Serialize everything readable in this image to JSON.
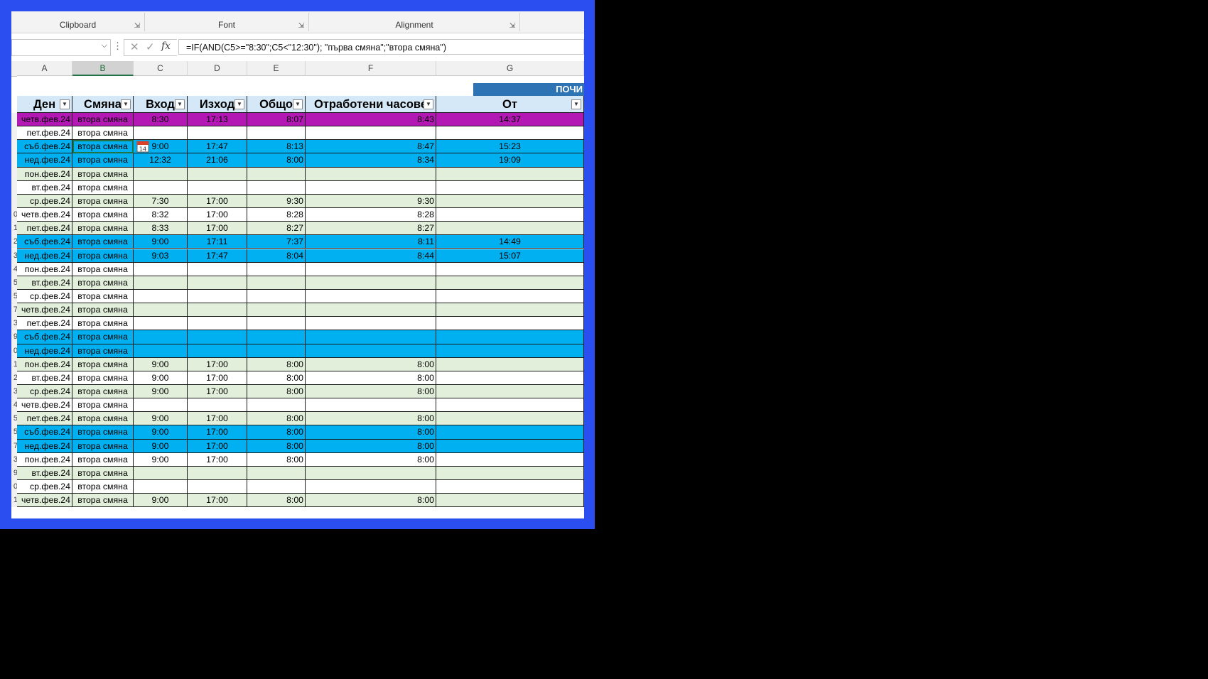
{
  "ribbon": {
    "groups": [
      {
        "label": "Clipboard"
      },
      {
        "label": "Font"
      },
      {
        "label": "Alignment"
      }
    ]
  },
  "formula_bar": {
    "name_box": "",
    "formula": "=IF(AND(C5>=\"8:30\";C5<\"12:30\"); \"първа смяна\";\"втора смяна\")",
    "fx_label": "fx"
  },
  "columns": [
    "A",
    "B",
    "C",
    "D",
    "E",
    "F",
    "G"
  ],
  "selected_column": "B",
  "group_header": "ПОЧИ",
  "table_headers": [
    "Ден",
    "Смяна",
    "Вход",
    "Изход",
    "Общо",
    "Отработени часове",
    "От"
  ],
  "row_numbers": [
    "",
    "",
    "",
    "",
    "",
    "",
    "",
    "0",
    "1",
    "2",
    "3",
    "4",
    "5",
    "5",
    "7",
    "3",
    "9",
    "0",
    "1",
    "2",
    "3",
    "4",
    "5",
    "5",
    "7",
    "3",
    "9",
    "0",
    "1"
  ],
  "rows": [
    {
      "style": "magenta",
      "cells": [
        "четв.фев.24",
        "втора смяна",
        "8:30",
        "17:13",
        "8:07",
        "8:43",
        "14:37"
      ]
    },
    {
      "style": "white",
      "cells": [
        "пет.фев.24",
        "втора смяна",
        "",
        "",
        "",
        "",
        ""
      ]
    },
    {
      "style": "blue",
      "cells": [
        "съб.фев.24",
        "втора смяна",
        "9:00",
        "17:47",
        "8:13",
        "8:47",
        "15:23"
      ]
    },
    {
      "style": "blue",
      "cells": [
        "нед.фев.24",
        "втора смяна",
        "12:32",
        "21:06",
        "8:00",
        "8:34",
        "19:09"
      ]
    },
    {
      "style": "green",
      "cells": [
        "пон.фев.24",
        "втора смяна",
        "",
        "",
        "",
        "",
        ""
      ]
    },
    {
      "style": "white",
      "cells": [
        "вт.фев.24",
        "втора смяна",
        "",
        "",
        "",
        "",
        ""
      ]
    },
    {
      "style": "green",
      "cells": [
        "ср.фев.24",
        "втора смяна",
        "7:30",
        "17:00",
        "9:30",
        "9:30",
        ""
      ]
    },
    {
      "style": "white",
      "cells": [
        "четв.фев.24",
        "втора смяна",
        "8:32",
        "17:00",
        "8:28",
        "8:28",
        ""
      ]
    },
    {
      "style": "green",
      "cells": [
        "пет.фев.24",
        "втора смяна",
        "8:33",
        "17:00",
        "8:27",
        "8:27",
        ""
      ]
    },
    {
      "style": "blue",
      "cells": [
        "съб.фев.24",
        "втора смяна",
        "9:00",
        "17:11",
        "7:37",
        "8:11",
        "14:49"
      ]
    },
    {
      "style": "blue",
      "cells": [
        "нед.фев.24",
        "втора смяна",
        "9:03",
        "17:47",
        "8:04",
        "8:44",
        "15:07"
      ]
    },
    {
      "style": "white",
      "cells": [
        "пон.фев.24",
        "втора смяна",
        "",
        "",
        "",
        "",
        ""
      ]
    },
    {
      "style": "green",
      "cells": [
        "вт.фев.24",
        "втора смяна",
        "",
        "",
        "",
        "",
        ""
      ]
    },
    {
      "style": "white",
      "cells": [
        "ср.фев.24",
        "втора смяна",
        "",
        "",
        "",
        "",
        ""
      ]
    },
    {
      "style": "green",
      "cells": [
        "четв.фев.24",
        "втора смяна",
        "",
        "",
        "",
        "",
        ""
      ]
    },
    {
      "style": "white",
      "cells": [
        "пет.фев.24",
        "втора смяна",
        "",
        "",
        "",
        "",
        ""
      ]
    },
    {
      "style": "blue",
      "cells": [
        "съб.фев.24",
        "втора смяна",
        "",
        "",
        "",
        "",
        ""
      ]
    },
    {
      "style": "blue",
      "cells": [
        "нед.фев.24",
        "втора смяна",
        "",
        "",
        "",
        "",
        ""
      ]
    },
    {
      "style": "green",
      "cells": [
        "пон.фев.24",
        "втора смяна",
        "9:00",
        "17:00",
        "8:00",
        "8:00",
        ""
      ]
    },
    {
      "style": "white",
      "cells": [
        "вт.фев.24",
        "втора смяна",
        "9:00",
        "17:00",
        "8:00",
        "8:00",
        ""
      ]
    },
    {
      "style": "green",
      "cells": [
        "ср.фев.24",
        "втора смяна",
        "9:00",
        "17:00",
        "8:00",
        "8:00",
        ""
      ]
    },
    {
      "style": "white",
      "cells": [
        "четв.фев.24",
        "втора смяна",
        "",
        "",
        "",
        "",
        ""
      ]
    },
    {
      "style": "green",
      "cells": [
        "пет.фев.24",
        "втора смяна",
        "9:00",
        "17:00",
        "8:00",
        "8:00",
        ""
      ]
    },
    {
      "style": "blue",
      "cells": [
        "съб.фев.24",
        "втора смяна",
        "9:00",
        "17:00",
        "8:00",
        "8:00",
        ""
      ]
    },
    {
      "style": "blue",
      "cells": [
        "нед.фев.24",
        "втора смяна",
        "9:00",
        "17:00",
        "8:00",
        "8:00",
        ""
      ]
    },
    {
      "style": "white",
      "cells": [
        "пон.фев.24",
        "втора смяна",
        "9:00",
        "17:00",
        "8:00",
        "8:00",
        ""
      ]
    },
    {
      "style": "green",
      "cells": [
        "вт.фев.24",
        "втора смяна",
        "",
        "",
        "",
        "",
        ""
      ]
    },
    {
      "style": "white",
      "cells": [
        "ср.фев.24",
        "втора смяна",
        "",
        "",
        "",
        "",
        ""
      ]
    },
    {
      "style": "green",
      "cells": [
        "четв.фев.24",
        "втора смяна",
        "9:00",
        "17:00",
        "8:00",
        "8:00",
        ""
      ]
    }
  ],
  "colors": {
    "magenta": "#b418b4",
    "blue": "#00b0f0",
    "green": "#e2efda",
    "white": "#ffffff",
    "frame": "#2b4ef0",
    "header_fill": "#d4e8f7",
    "group_fill": "#2e74b5"
  },
  "icons": {
    "cancel": "x-icon",
    "enter": "check-icon",
    "function": "fx-icon",
    "filter": "filter-dropdown-icon",
    "date_picker": "calendar-icon"
  },
  "calendar_icon_text": "14"
}
